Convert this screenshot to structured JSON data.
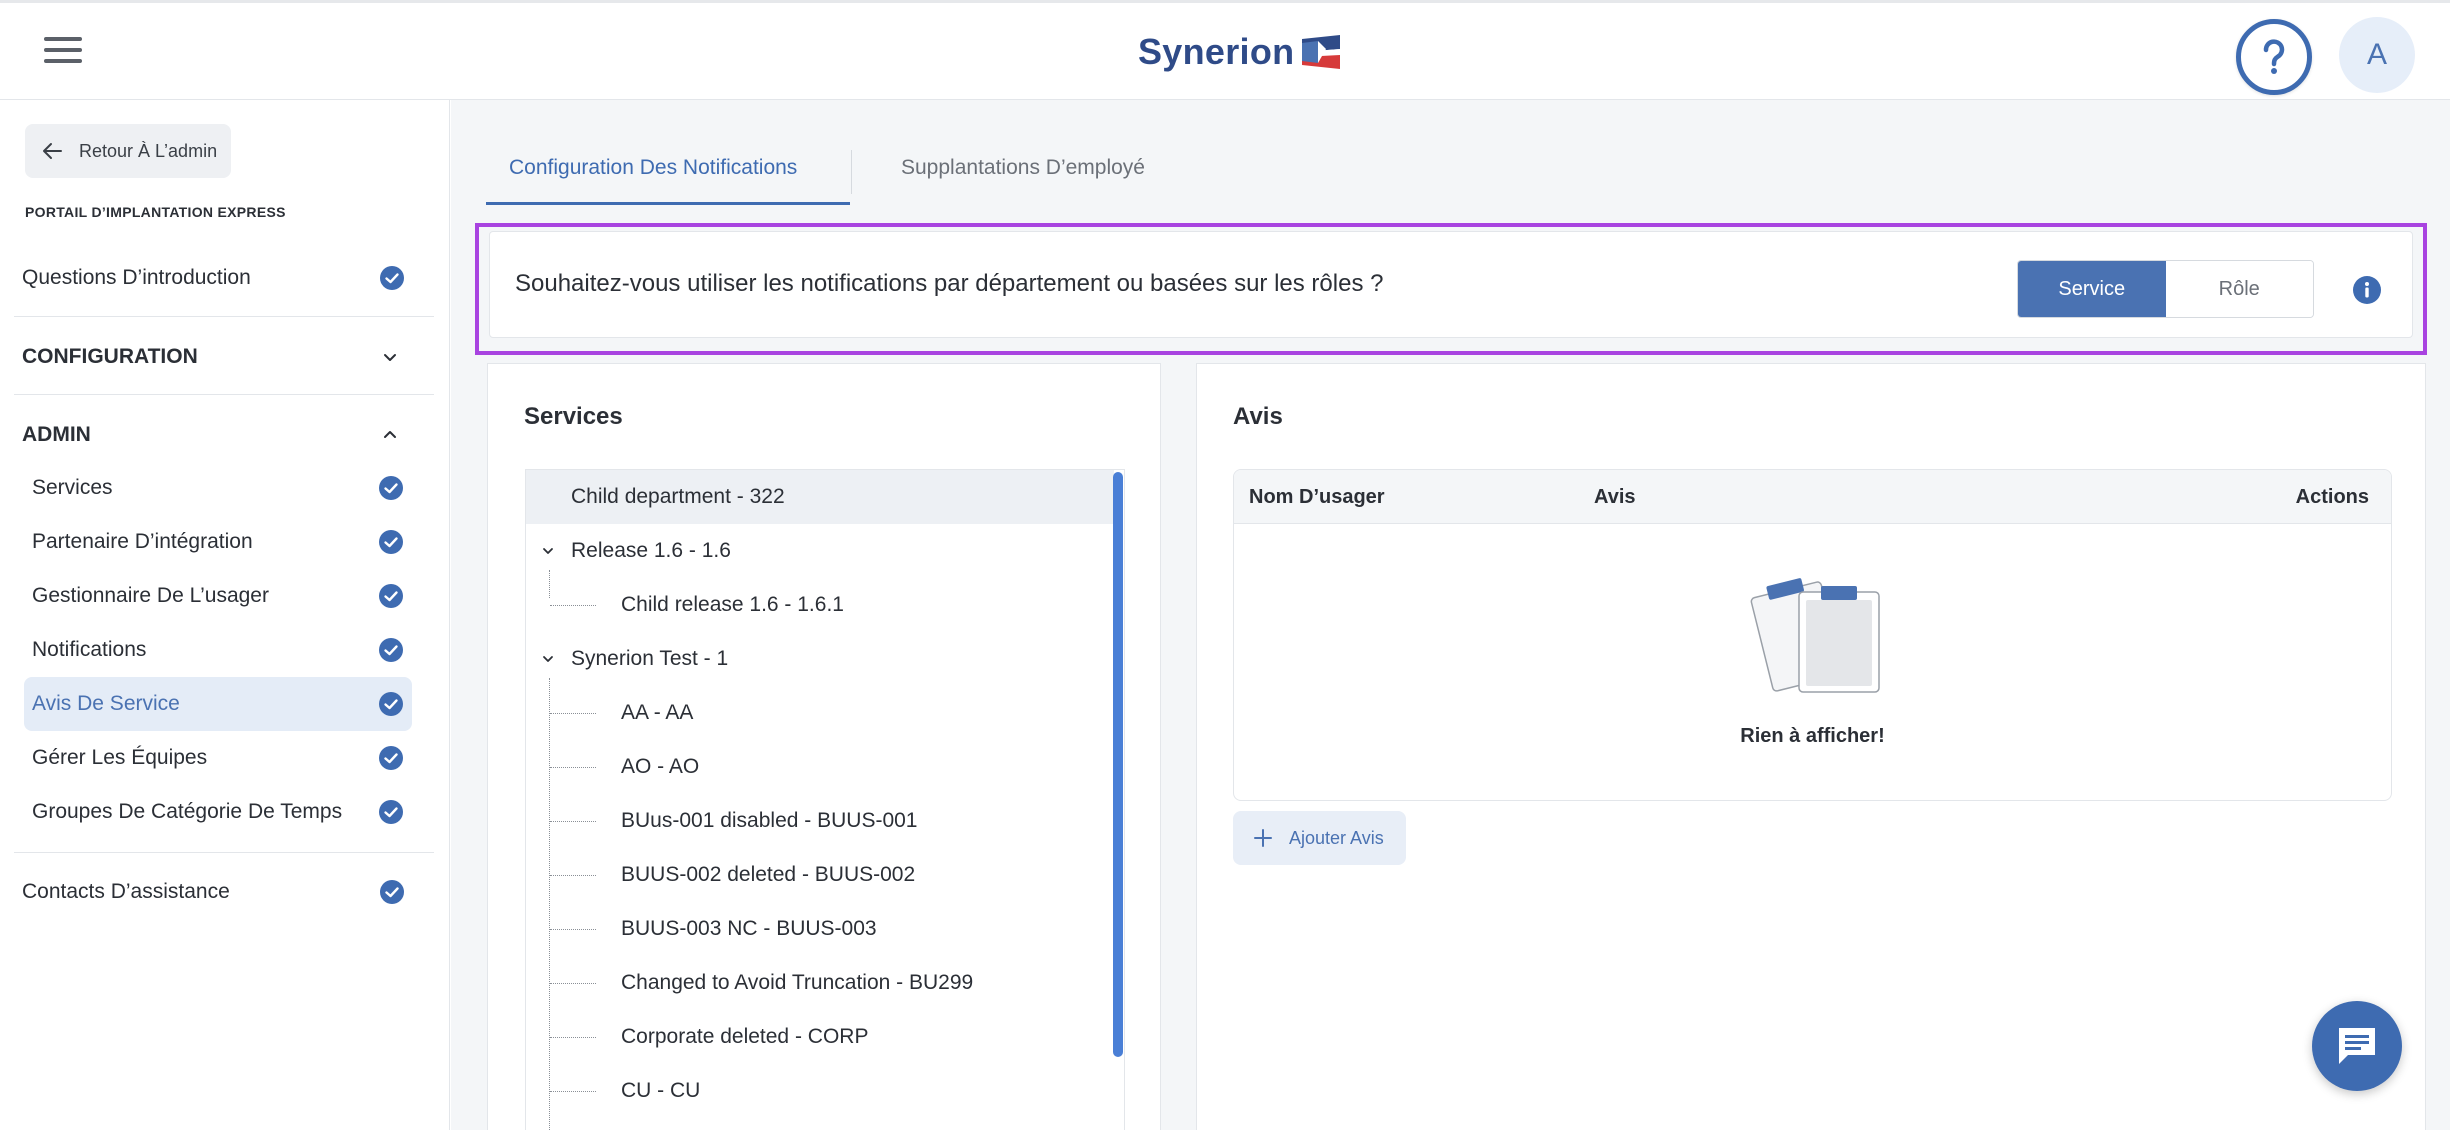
{
  "header": {
    "logo_text": "Synerion",
    "avatar_initial": "A"
  },
  "sidebar": {
    "back_label": "Retour À L’admin",
    "portal_label": "PORTAIL D’IMPLANTATION EXPRESS",
    "intro_label": "Questions D’introduction",
    "config_label": "CONFIGURATION",
    "admin_label": "ADMIN",
    "admin_items": [
      {
        "label": "Services"
      },
      {
        "label": "Partenaire D’intégration"
      },
      {
        "label": "Gestionnaire De L’usager"
      },
      {
        "label": "Notifications"
      },
      {
        "label": "Avis De Service"
      },
      {
        "label": "Gérer Les Équipes"
      },
      {
        "label": "Groupes De Catégorie De Temps"
      }
    ],
    "support_label": "Contacts D’assistance",
    "active_item": "Avis De Service"
  },
  "tabs": [
    {
      "label": "Configuration Des Notifications",
      "active": true
    },
    {
      "label": "Supplantations D’employé",
      "active": false
    }
  ],
  "question": {
    "text": "Souhaitez-vous utiliser les notifications par département ou basées sur les rôles ?",
    "options": [
      "Service",
      "Rôle"
    ],
    "selected": "Service"
  },
  "services_panel": {
    "title": "Services",
    "tree": [
      {
        "label": "Child department - 322",
        "level": 0,
        "selected": true
      },
      {
        "label": "Release 1.6 - 1.6",
        "level": 0,
        "expanded": true
      },
      {
        "label": "Child release 1.6 - 1.6.1",
        "level": 1
      },
      {
        "label": "Synerion Test - 1",
        "level": 0,
        "expanded": true
      },
      {
        "label": "AA - AA",
        "level": 1
      },
      {
        "label": "AO - AO",
        "level": 1
      },
      {
        "label": "BUus-001 disabled - BUUS-001",
        "level": 1
      },
      {
        "label": "BUUS-002 deleted - BUUS-002",
        "level": 1
      },
      {
        "label": "BUUS-003 NC - BUUS-003",
        "level": 1
      },
      {
        "label": "Changed to Avoid Truncation - BU299",
        "level": 1
      },
      {
        "label": "Corporate deleted - CORP",
        "level": 1
      },
      {
        "label": "CU - CU",
        "level": 1
      }
    ]
  },
  "avis_panel": {
    "title": "Avis",
    "columns": [
      "Nom D’usager",
      "Avis",
      "Actions"
    ],
    "empty_text": "Rien à afficher!",
    "add_label": "Ajouter Avis"
  },
  "colors": {
    "brand_blue": "#3e6bb1",
    "highlight_purple": "#a843e0",
    "scroll_blue": "#4a7fd6"
  },
  "icons": {
    "menu": "hamburger-icon",
    "help": "question-circle-icon",
    "back": "arrow-left-icon",
    "check": "check-circle-icon",
    "info": "info-circle-icon",
    "add": "plus-icon",
    "chat": "chat-bubble-icon"
  }
}
